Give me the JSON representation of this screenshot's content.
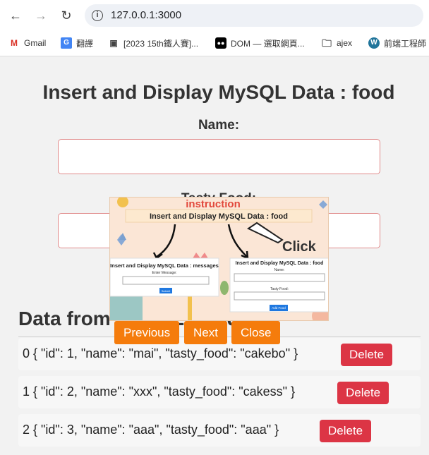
{
  "browser": {
    "url": "127.0.0.1:3000",
    "bookmarks": [
      {
        "icon": "gmail-icon",
        "label": "Gmail"
      },
      {
        "icon": "translate-icon",
        "label": "翻譯"
      },
      {
        "icon": "document-icon",
        "label": "[2023 15th鐵人賽]..."
      },
      {
        "icon": "medium-icon",
        "label": "DOM — 選取網頁..."
      },
      {
        "icon": "folder-icon",
        "label": "ajex"
      },
      {
        "icon": "wordpress-icon",
        "label": "前端工程師"
      }
    ]
  },
  "form": {
    "title": "Insert and Display MySQL Data : food",
    "name_label": "Name:",
    "name_value": "",
    "tasty_label": "Tasty Food:",
    "tasty_value": ""
  },
  "data_section": {
    "title": "Data from MySQL: food",
    "rows": [
      {
        "text": "0 { \"id\": 1, \"name\": \"mai\", \"tasty_food\": \"cakebo\" }",
        "delete": "Delete"
      },
      {
        "text": "1 { \"id\": 2, \"name\": \"xxx\", \"tasty_food\": \"cakess\" }",
        "delete": "Delete"
      },
      {
        "text": "2 { \"id\": 3, \"name\": \"aaa\", \"tasty_food\": \"aaa\" }",
        "delete": "Delete"
      }
    ]
  },
  "tour": {
    "banner": "instruction",
    "image_title": "Insert and Display MySQL Data : food",
    "click_label": "Click",
    "left_card": {
      "title": "Insert and Display MySQL Data : messages",
      "label": "Enter Message:",
      "button": "Submit"
    },
    "right_card": {
      "title": "Insert and Display MySQL Data : food",
      "name_label": "Name:",
      "tasty_label": "Tasty Food:",
      "button": "Add Food"
    },
    "previous": "Previous",
    "next": "Next",
    "close": "Close"
  },
  "colors": {
    "delete": "#dc3545",
    "tour_button": "#f57c0c",
    "input_border": "#e08a8a"
  }
}
